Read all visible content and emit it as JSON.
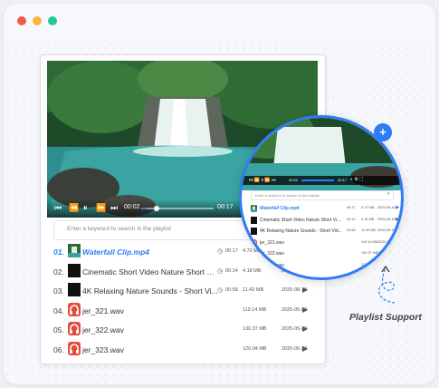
{
  "player": {
    "current_time": "00:02",
    "end_time": "00:17",
    "progress_fraction": 0.08,
    "search_placeholder": "Enter a keyword to search in the playlist",
    "rows": [
      {
        "num": "01.",
        "name": "Waterfall Clip.mp4",
        "duration": "00:17",
        "size": "4.72 MB",
        "date": "2025-08-19",
        "active": true,
        "thumb": "video"
      },
      {
        "num": "02.",
        "name": "Cinematic Short Video Nature Short Vi...",
        "duration": "00:14",
        "size": "4.18 MB",
        "date": "2025-08",
        "thumb": "video-dark"
      },
      {
        "num": "03.",
        "name": "4K Relaxing Nature Sounds - Short Vi...",
        "duration": "00:58",
        "size": "11.42 MB",
        "date": "2025-08-19",
        "thumb": "video-dark"
      },
      {
        "num": "04.",
        "name": "jer_321.wav",
        "duration": "",
        "size": "119.14 MB",
        "date": "2025-05-29",
        "thumb": "headphones"
      },
      {
        "num": "05.",
        "name": "jer_322.wav",
        "duration": "",
        "size": "130.37 MB",
        "date": "2025-05-29",
        "thumb": "headphones"
      },
      {
        "num": "06.",
        "name": "jer_323.wav",
        "duration": "",
        "size": "120.04 MB",
        "date": "2025-05-29",
        "thumb": "headphones"
      }
    ]
  },
  "zoom": {
    "current_time": "00:02",
    "end_time": "00:17",
    "search_placeholder": "Enter a keyword to search in the playlist",
    "add_label": "+",
    "rows": [
      {
        "name": "Waterfall Clip.mp4",
        "duration": "00:17",
        "size": "4.72 MB",
        "date": "2025-08-19",
        "active": true,
        "thumb": "video"
      },
      {
        "name": "Cinematic Short Video Nature Short Vi...",
        "duration": "00:14",
        "size": "4.18 MB",
        "date": "2025-08-19",
        "thumb": "video-dark"
      },
      {
        "name": "4K Relaxing Nature Sounds - Short Vid...",
        "duration": "00:58",
        "size": "11.42 MB",
        "date": "2025-08-19",
        "thumb": "video-dark"
      },
      {
        "name": "jer_321.wav",
        "duration": "",
        "size": "119.14 MB",
        "date": "2025-05-29",
        "thumb": "headphones"
      },
      {
        "name": "jer_322.wav",
        "duration": "",
        "size": "130.37 MB",
        "date": "2025-05-29",
        "thumb": "headphones"
      },
      {
        "name": "jer_323.wav",
        "duration": "",
        "size": "120.04 MB",
        "date": "2025-05-29",
        "thumb": "headphones"
      }
    ]
  },
  "caption": "Playlist Support",
  "colors": {
    "accent": "#2f7cf5",
    "headphones": "#e24a3b"
  }
}
